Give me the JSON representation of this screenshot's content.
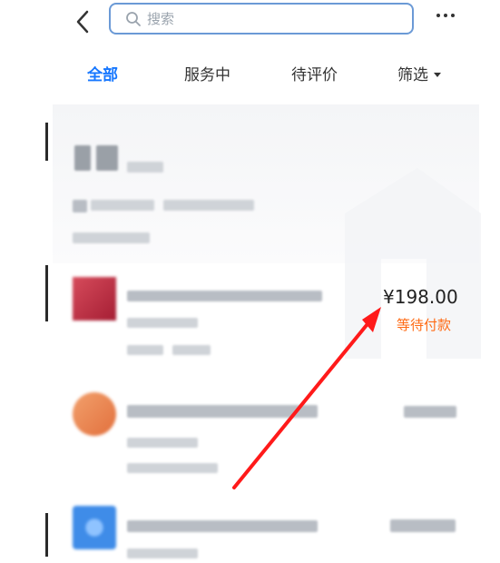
{
  "header": {
    "search_placeholder": "搜索",
    "back_icon": "back-icon",
    "more_icon": "more-icon"
  },
  "tabs": [
    {
      "label": "全部",
      "active": true
    },
    {
      "label": "服务中",
      "active": false
    },
    {
      "label": "待评价",
      "active": false
    },
    {
      "label": "筛选",
      "active": false
    }
  ],
  "orders": [
    {
      "price": "¥198.00",
      "status": "等待付款"
    }
  ],
  "colors": {
    "accent": "#1677ff",
    "status": "#ff6a13",
    "annotation": "#ff1a1a"
  }
}
